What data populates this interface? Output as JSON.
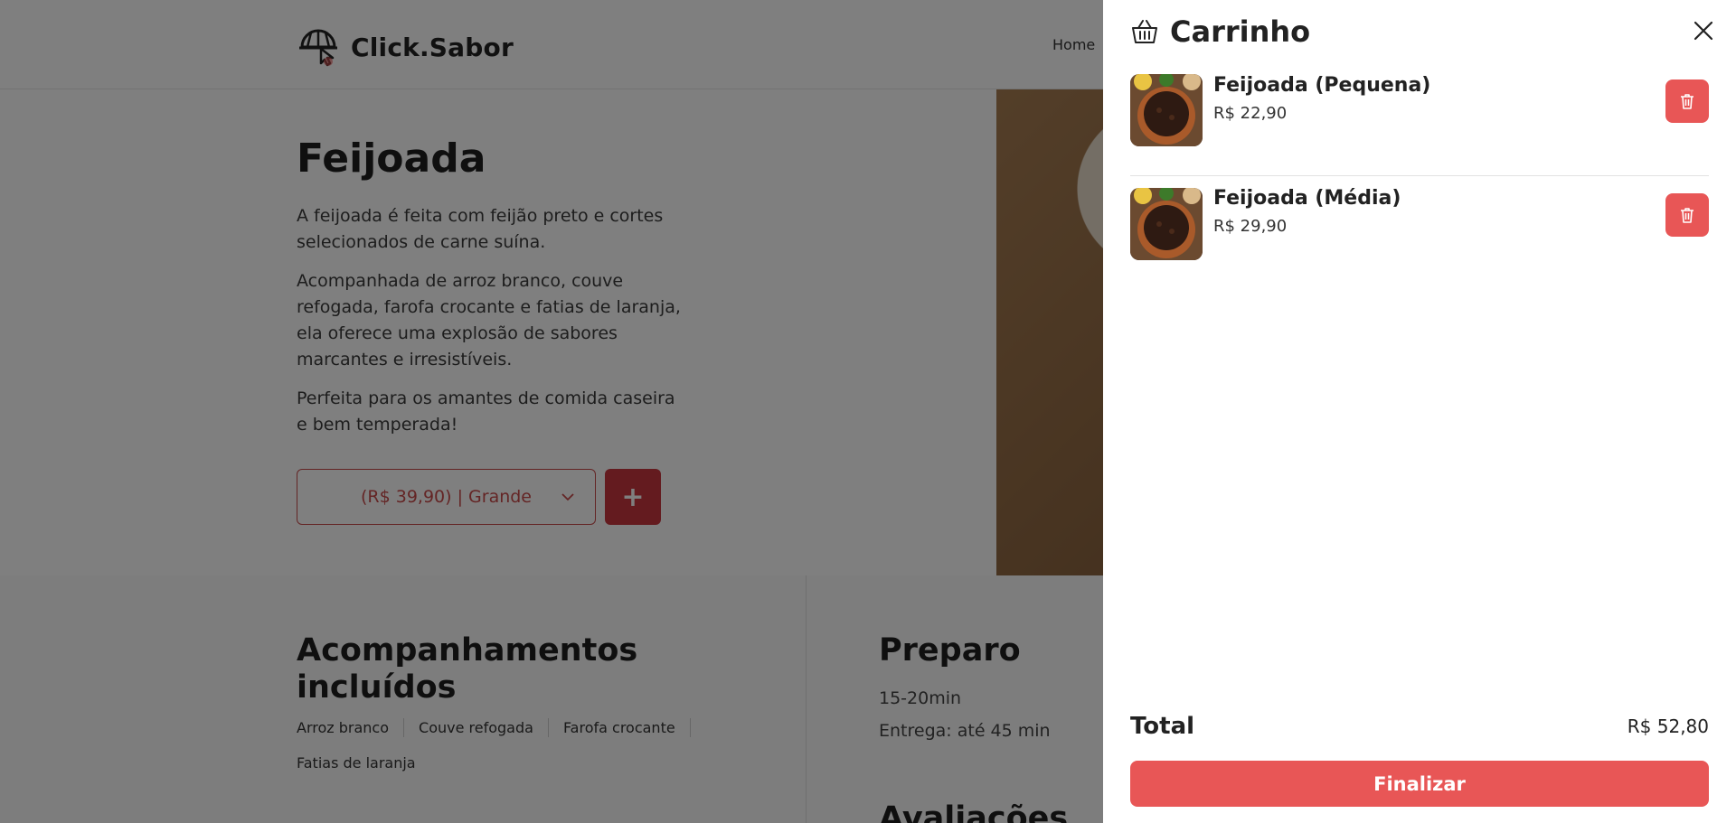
{
  "header": {
    "brand": "Click.Sabor",
    "nav": [
      "Home"
    ]
  },
  "product": {
    "title": "Feijoada",
    "paragraphs": [
      "A feijoada é feita com feijão preto e cortes selecionados de carne suína.",
      "Acompanhada de arroz branco, couve refogada, farofa crocante e fatias de laranja, ela oferece uma explosão de sabores marcantes e irresistíveis.",
      "Perfeita para os amantes de comida caseira e bem temperada!"
    ],
    "size_select": "(R$ 39,90) | Grande",
    "add_label": "+"
  },
  "sides": {
    "title": "Acompanhamentos incluídos",
    "items": [
      "Arroz branco",
      "Couve refogada",
      "Farofa crocante",
      "Fatias de laranja"
    ]
  },
  "prep": {
    "title": "Preparo",
    "time": "15-20min",
    "delivery": "Entrega: até 45 min",
    "reviews_title": "Avaliações"
  },
  "cart": {
    "title": "Carrinho",
    "items": [
      {
        "name": "Feijoada (Pequena)",
        "price": "R$ 22,90"
      },
      {
        "name": "Feijoada (Média)",
        "price": "R$ 29,90"
      }
    ],
    "total_label": "Total",
    "total_value": "R$ 52,80",
    "finalize_label": "Finalizar"
  },
  "colors": {
    "accent": "#e85656",
    "brand_red": "#c8373f",
    "overlay": "rgba(0,0,0,0.5)"
  },
  "icons": [
    "logo-icon",
    "basket-icon",
    "close-icon",
    "trash-icon",
    "chevron-down-icon"
  ]
}
